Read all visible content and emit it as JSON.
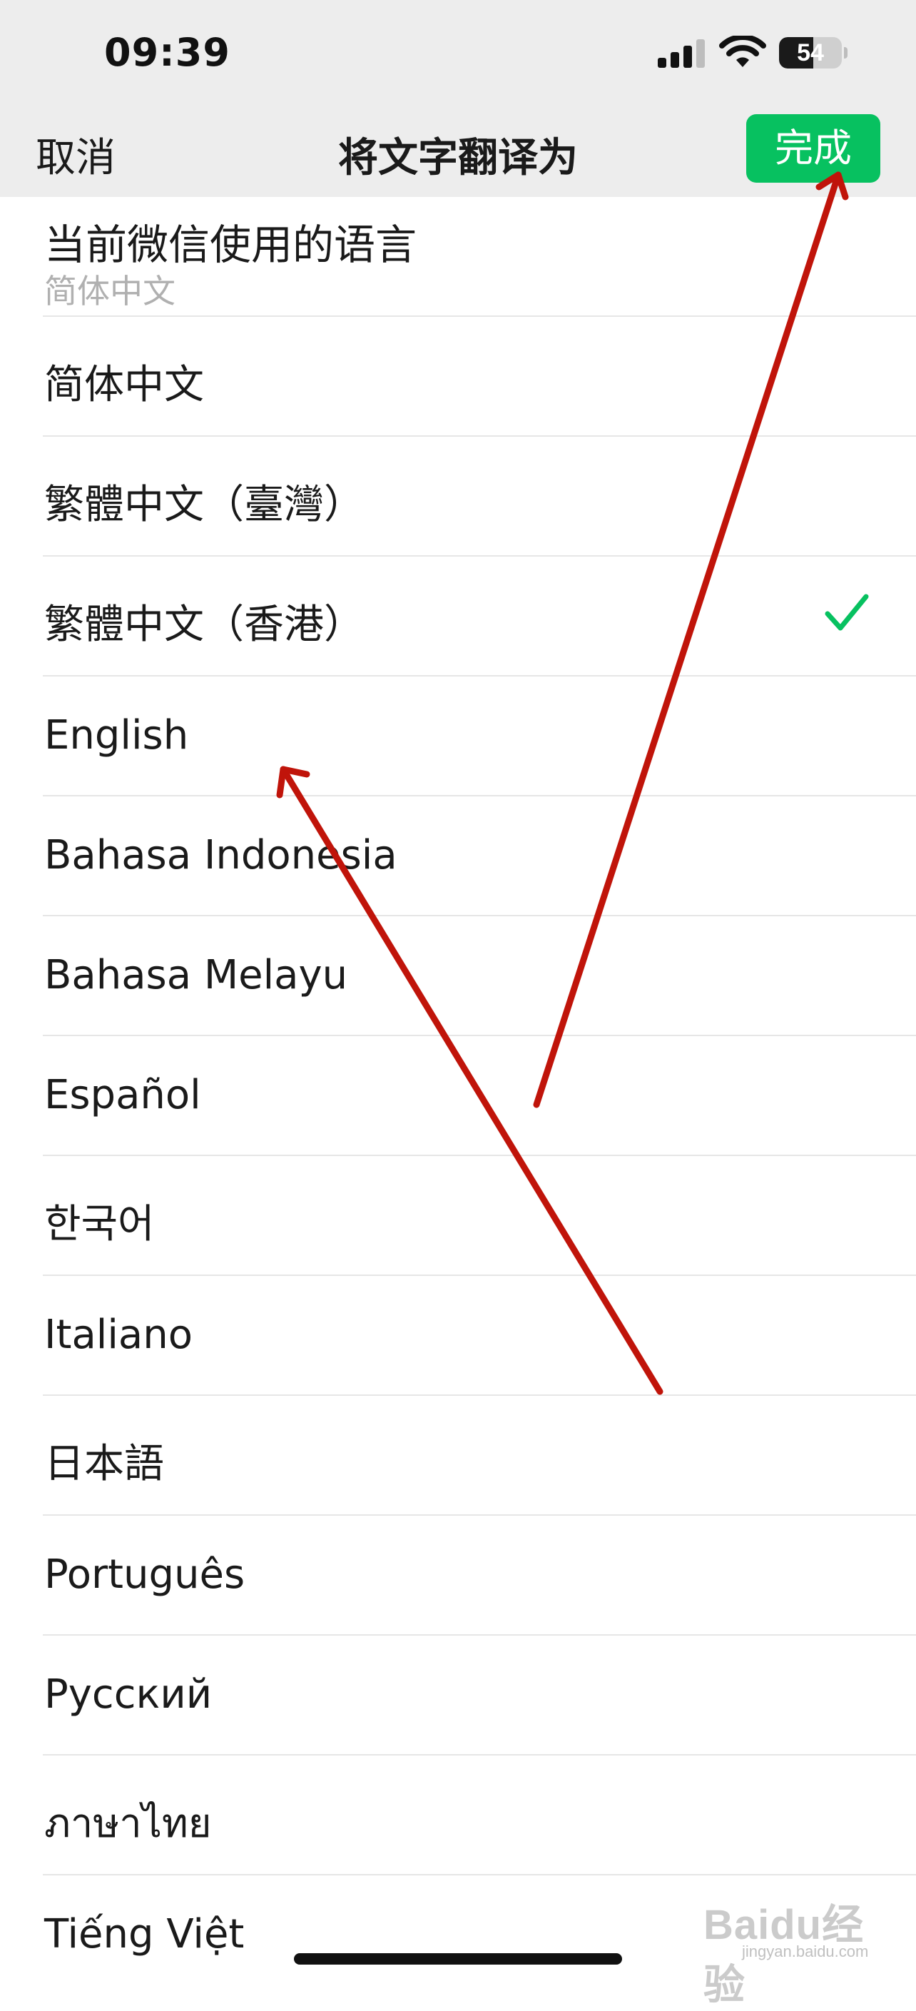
{
  "status_bar": {
    "time": "09:39",
    "battery_percent": "54",
    "battery_level": 0.54,
    "signal_icon": "cellular-signal-icon",
    "wifi_icon": "wifi-icon"
  },
  "header": {
    "cancel_label": "取消",
    "title": "将文字翻译为",
    "done_label": "完成",
    "done_color": "#07c160"
  },
  "current_language": {
    "label": "当前微信使用的语言",
    "value": "简体中文"
  },
  "languages": [
    {
      "name": "简体中文",
      "selected": false
    },
    {
      "name": "繁體中文（臺灣）",
      "selected": false
    },
    {
      "name": "繁體中文（香港）",
      "selected": true
    },
    {
      "name": "English",
      "selected": false
    },
    {
      "name": "Bahasa Indonesia",
      "selected": false
    },
    {
      "name": "Bahasa Melayu",
      "selected": false
    },
    {
      "name": "Español",
      "selected": false
    },
    {
      "name": "한국어",
      "selected": false
    },
    {
      "name": "Italiano",
      "selected": false
    },
    {
      "name": "日本語",
      "selected": false
    },
    {
      "name": "Português",
      "selected": false
    },
    {
      "name": "Русский",
      "selected": false
    },
    {
      "name": "ภาษาไทย",
      "selected": false
    },
    {
      "name": "Tiếng Việt",
      "selected": false
    }
  ],
  "check_color": "#07c160",
  "annotation_color": "#c0140a",
  "watermark": {
    "brand": "Baidu经验",
    "url": "jingyan.baidu.com"
  }
}
